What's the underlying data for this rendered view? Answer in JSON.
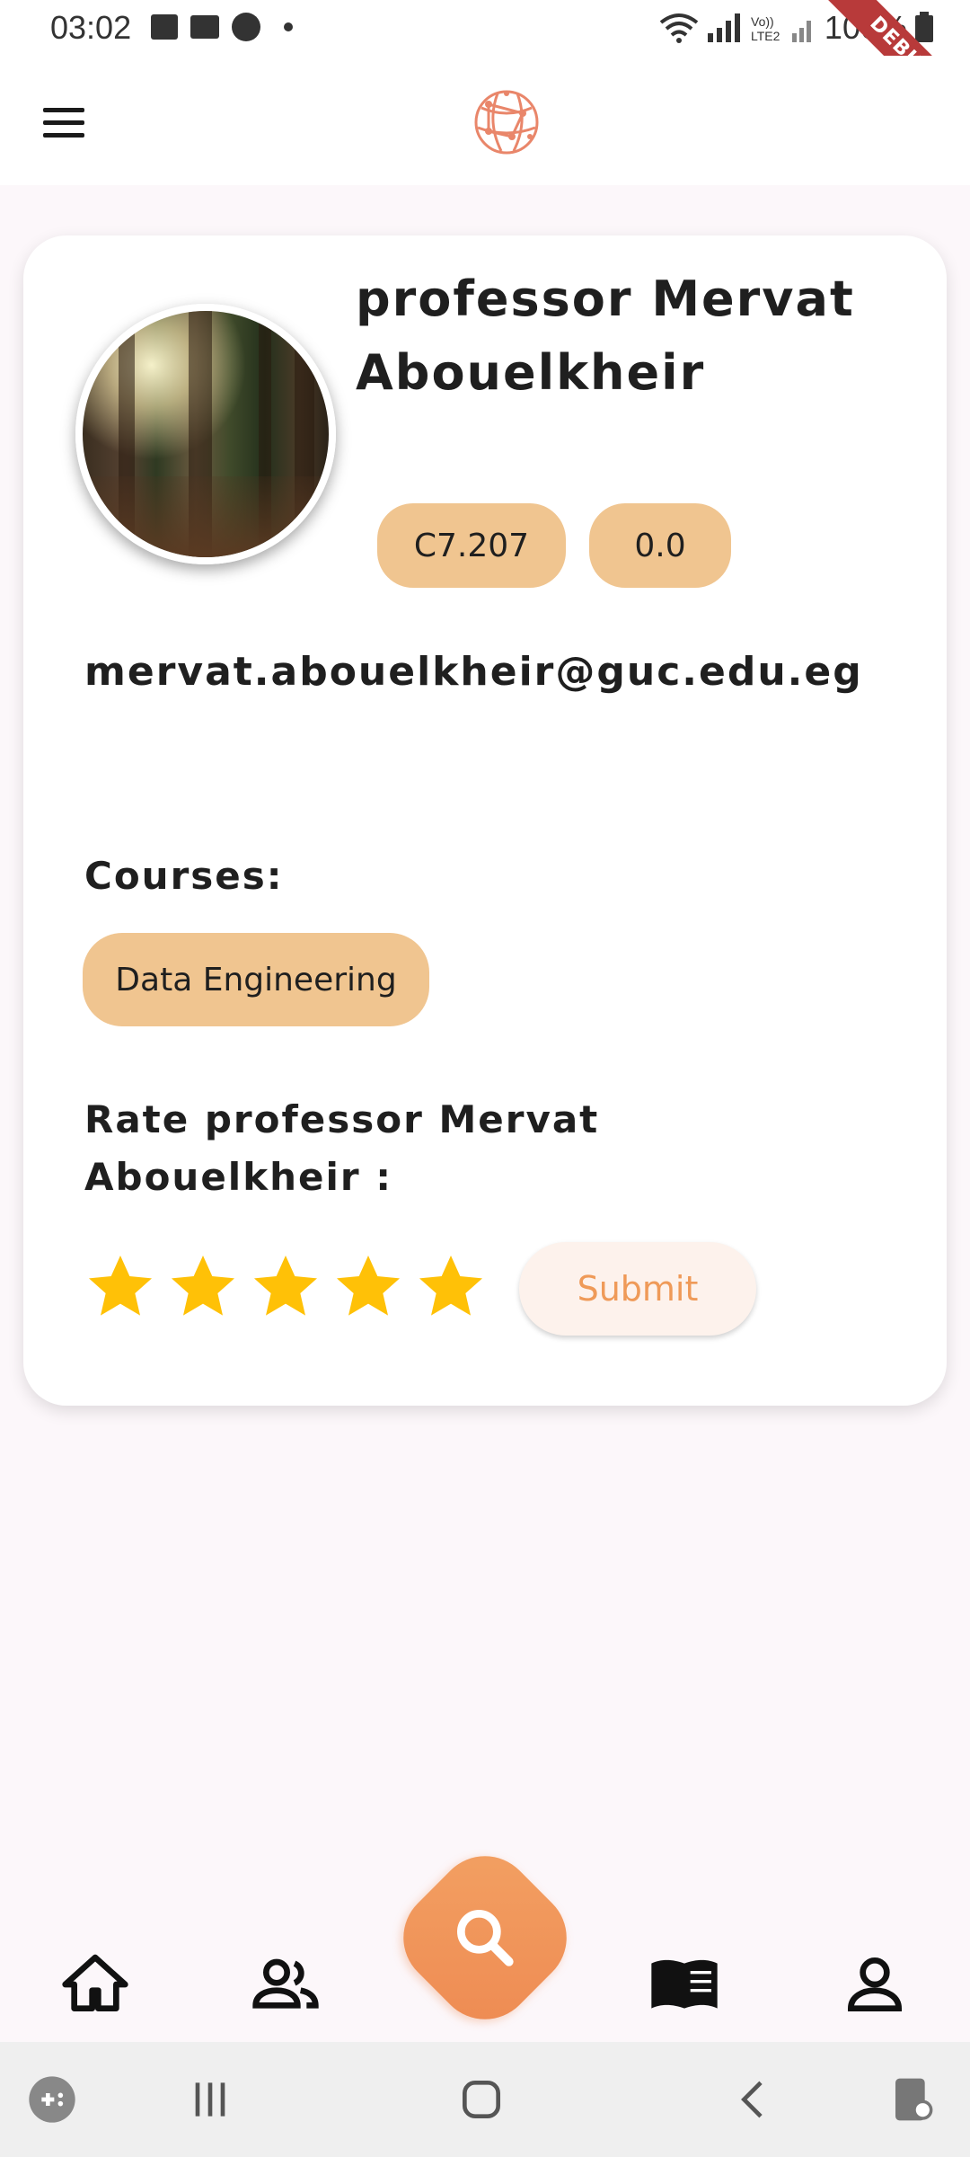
{
  "status_bar": {
    "time": "03:02",
    "battery": "100%",
    "debug_label": "DEBUG"
  },
  "app_bar": {
    "menu_icon": "menu-icon",
    "logo_icon": "globe-network-logo"
  },
  "profile": {
    "name": "professor Mervat Abouelkheir",
    "office": "C7.207",
    "rating": "0.0",
    "email": "mervat.abouelkheir@guc.edu.eg",
    "courses_label": "Courses:",
    "courses": [
      "Data Engineering"
    ],
    "rate_label": "Rate professor Mervat Abouelkheir :",
    "stars": 5,
    "submit_label": "Submit"
  },
  "bottom_nav": {
    "items": [
      "home-icon",
      "people-icon",
      "search-icon",
      "book-icon",
      "account-icon"
    ],
    "accent": "#ee8a52"
  },
  "colors": {
    "chip": "#f0c590",
    "star": "#ffc107",
    "submit_text": "#ef9a58",
    "background": "#fcf7fa"
  }
}
